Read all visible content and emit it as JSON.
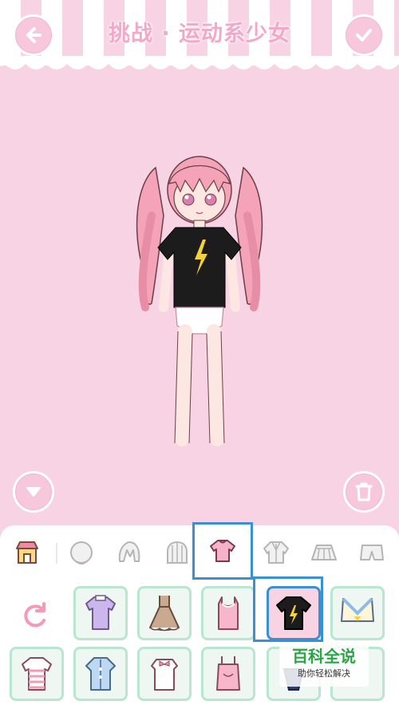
{
  "header": {
    "title": "挑战 · 运动系少女",
    "back_icon": "arrow-left-icon",
    "confirm_icon": "checkmark-icon"
  },
  "stage": {
    "collapse_icon": "triangle-down-icon",
    "trash_icon": "trash-icon"
  },
  "closet": {
    "tabs": [
      {
        "icon": "shop-icon",
        "active": false
      },
      {
        "icon": "face-icon",
        "active": false
      },
      {
        "icon": "front-hair-icon",
        "active": false
      },
      {
        "icon": "back-hair-icon",
        "active": false
      },
      {
        "icon": "tshirt-icon",
        "active": true
      },
      {
        "icon": "jacket-icon",
        "active": false
      },
      {
        "icon": "skirt-icon",
        "active": false
      },
      {
        "icon": "shorts-icon",
        "active": false
      }
    ],
    "reset_icon": "reset-icon",
    "items_row1": [
      "lavender-tee",
      "brown-ruffle-dress",
      "pink-tank-top",
      "black-lightning-tee",
      "sailor-crop-top"
    ],
    "items_row2": [
      "striped-tee",
      "blue-lace-blouse",
      "white-bow-top",
      "pink-camisole",
      "navy-frill-top"
    ],
    "selected_item": "black-lightning-tee"
  },
  "colors": {
    "background": "#f7d3e4",
    "accent_pink": "#f2a8c8",
    "selection_blue": "#3b8fd4",
    "slot_border": "#b9e6d0"
  },
  "watermark": {
    "main": "百科全说",
    "sub": "助你轻松解决"
  }
}
